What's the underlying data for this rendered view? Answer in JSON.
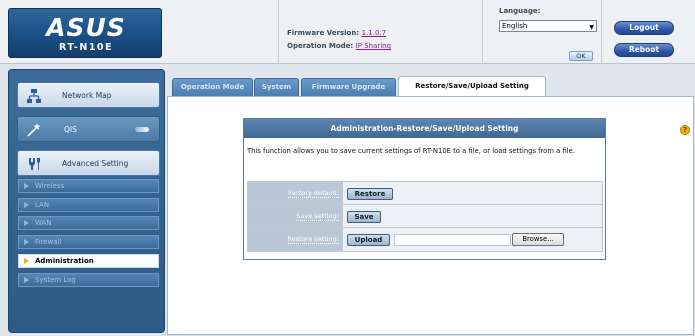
{
  "header": {
    "logo": "ASUS",
    "model": "RT-N10E",
    "firmware_label": "Firmware Version:",
    "firmware_value": "1.1.0.7",
    "op_mode_label": "Operation Mode:",
    "op_mode_value": "IP Sharing",
    "language_label": "Language:",
    "language_value": "English",
    "ok_label": "OK",
    "logout_label": "Logout",
    "reboot_label": "Reboot"
  },
  "sidebar": {
    "main_items": [
      {
        "label": "Network Map",
        "icon": "network-map-icon"
      },
      {
        "label": "QIS",
        "icon": "qis-wand-icon"
      },
      {
        "label": "Advanced Setting",
        "icon": "advanced-setting-icon"
      }
    ],
    "sub_items": [
      {
        "label": "Wireless"
      },
      {
        "label": "LAN"
      },
      {
        "label": "WAN"
      },
      {
        "label": "Firewall"
      },
      {
        "label": "Administration",
        "active": true
      },
      {
        "label": "System Log"
      }
    ]
  },
  "tabs": [
    {
      "label": "Operation Mode"
    },
    {
      "label": "System"
    },
    {
      "label": "Firmware Upgrade"
    },
    {
      "label": "Restore/Save/Upload Setting",
      "active": true
    }
  ],
  "panel": {
    "title": "Administration-Restore/Save/Upload Setting",
    "description": "This function allows you to save current settings of RT-N10E to a file, or load settings from a file.",
    "rows": [
      {
        "label": "Factory default:",
        "button": "Restore"
      },
      {
        "label": "Save setting:",
        "button": "Save"
      },
      {
        "label": "Restore setting:",
        "button": "Upload",
        "file_value": "",
        "browse": "Browse..."
      }
    ]
  },
  "colors": {
    "accent": "#2c57a8",
    "sidebar": "#3c6c9a",
    "active_marker": "#f2b705"
  }
}
